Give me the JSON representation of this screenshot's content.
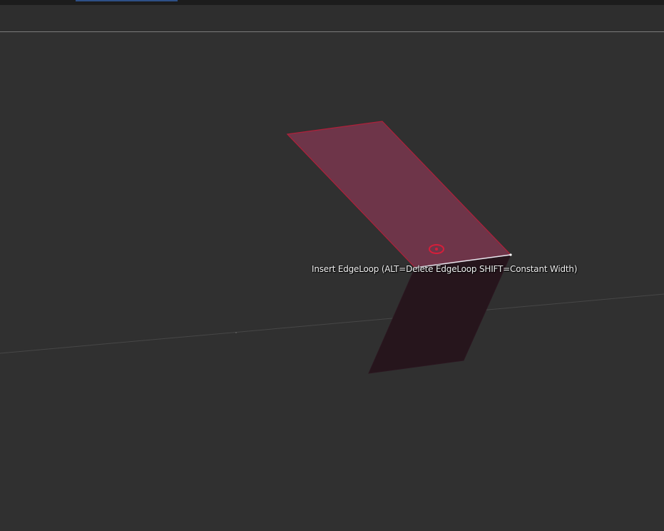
{
  "app": {
    "active_tab_color": "#2d4f86",
    "background_color": "#303030"
  },
  "viewport": {
    "tool_hint": "Insert EdgeLoop (ALT=Delete EdgeLoop SHIFT=Constant Width)",
    "mesh": {
      "upper_face_color": "#6e3549",
      "lower_face_color": "#26151c",
      "edge_color": "#b0203a",
      "hovered_edge_color": "#e8e8f0",
      "pivot_marker_color": "#d61e3a"
    },
    "grid_line_color": "#4a4a4a",
    "icons": [
      "pivot-gizmo-icon"
    ]
  }
}
